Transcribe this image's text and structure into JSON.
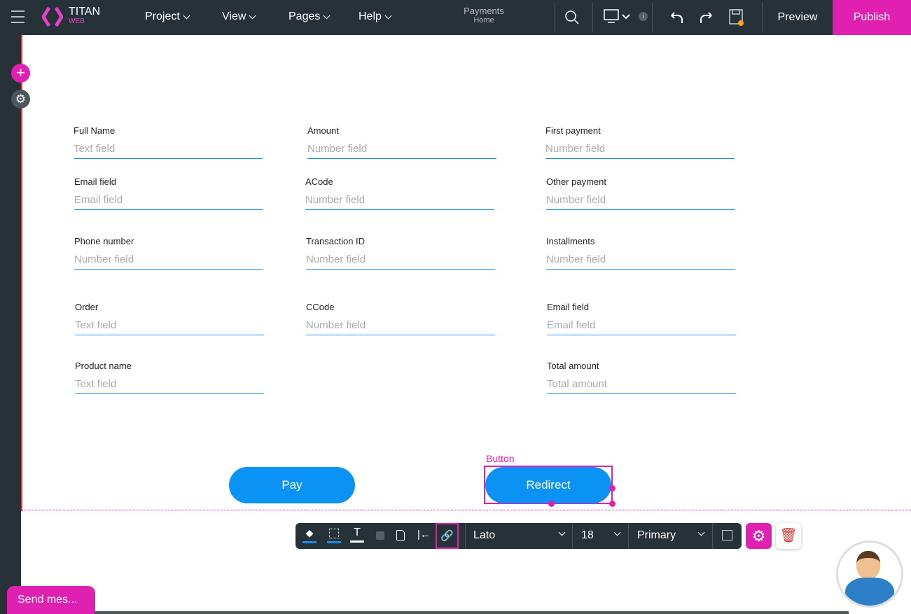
{
  "header": {
    "logo_title": "TITAN",
    "logo_sub": "WEB",
    "menus": [
      "Project",
      "View",
      "Pages",
      "Help"
    ],
    "page_title": "Payments",
    "page_sub": "Home",
    "info_badge": "i",
    "preview": "Preview",
    "publish": "Publish",
    "accent": "#e020b0"
  },
  "form": {
    "fields": [
      {
        "label": "Full Name",
        "placeholder": "Text field"
      },
      {
        "label": "Email field",
        "placeholder": "Email field"
      },
      {
        "label": "Phone number",
        "placeholder": "Number field"
      },
      {
        "label": "Order",
        "placeholder": "Text field"
      },
      {
        "label": "Product name",
        "placeholder": "Text field"
      },
      {
        "label": "Amount",
        "placeholder": "Number field"
      },
      {
        "label": "ACode",
        "placeholder": "Number field"
      },
      {
        "label": "Transaction ID",
        "placeholder": "Number field"
      },
      {
        "label": "CCode",
        "placeholder": "Number field"
      },
      {
        "label": "First payment",
        "placeholder": "Number field"
      },
      {
        "label": "Other payment",
        "placeholder": "Number field"
      },
      {
        "label": "Installments",
        "placeholder": "Number field"
      },
      {
        "label": "Email field",
        "placeholder": "Email field"
      },
      {
        "label": "Total amount",
        "placeholder": "Total amount"
      }
    ],
    "pay": "Pay",
    "redirect": "Redirect",
    "selection_label": "Button"
  },
  "toolbar": {
    "font": "Lato",
    "size": "18",
    "style": "Primary"
  },
  "chat": {
    "label": "Send mes..."
  }
}
